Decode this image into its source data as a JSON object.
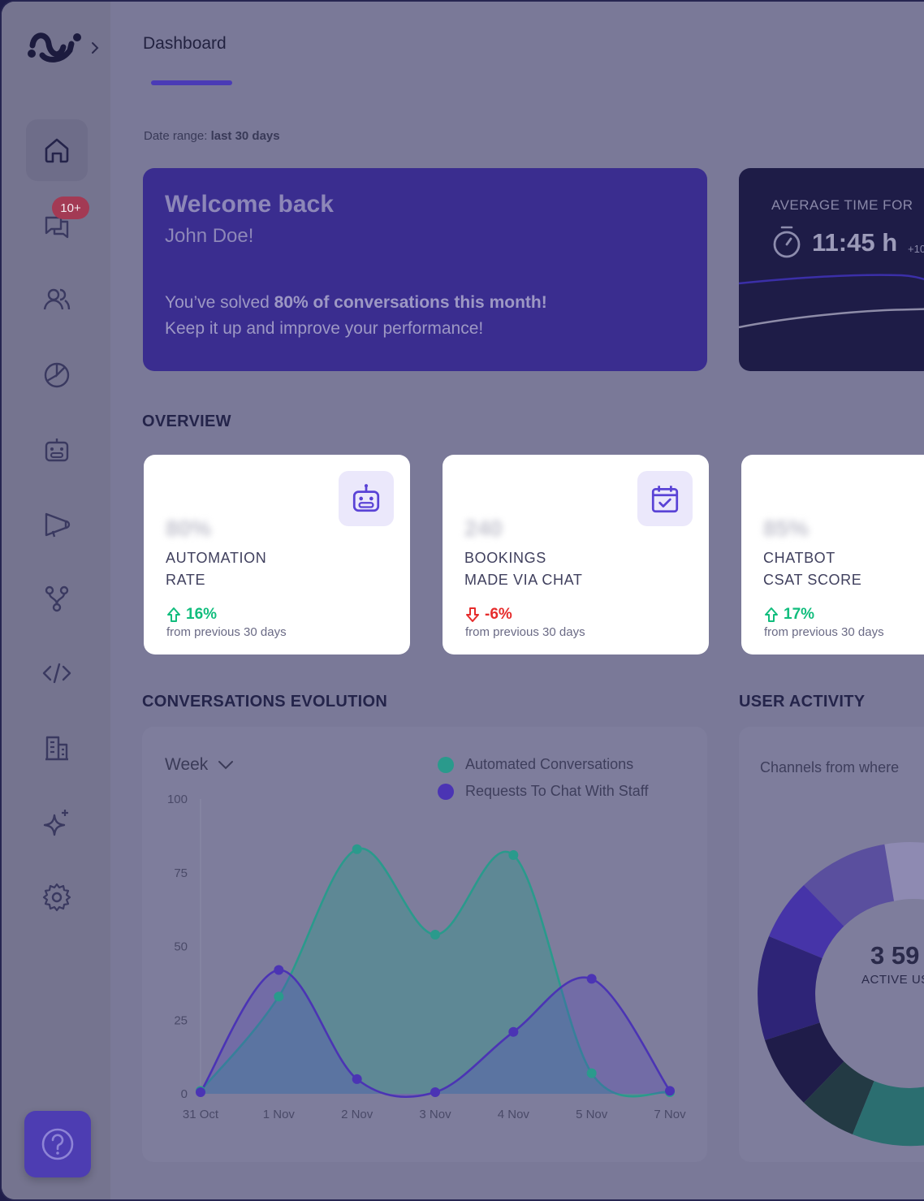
{
  "sidebar": {
    "badge": "10+",
    "items": [
      {
        "icon": "home-icon"
      },
      {
        "icon": "chat-icon"
      },
      {
        "icon": "users-icon"
      },
      {
        "icon": "pie-chart-icon"
      },
      {
        "icon": "robot-icon"
      },
      {
        "icon": "megaphone-icon"
      },
      {
        "icon": "workflow-icon"
      },
      {
        "icon": "code-icon"
      },
      {
        "icon": "building-icon"
      },
      {
        "icon": "sparkles-icon"
      },
      {
        "icon": "gear-icon"
      }
    ],
    "help_icon": "help-circle-icon"
  },
  "header": {
    "title": "Dashboard",
    "date_range_label": "Date range:",
    "date_range_value": "last 30 days"
  },
  "welcome": {
    "heading": "Welcome back",
    "name": "John Doe!",
    "msg_prefix": "You’ve solved ",
    "msg_bold": "80% of conversations this month!",
    "msg_line2": "Keep it up and improve your performance!"
  },
  "avg_time": {
    "label": "AVERAGE TIME FOR",
    "value": "11:45 h",
    "delta": "+10"
  },
  "overview": {
    "heading": "OVERVIEW",
    "cards": [
      {
        "value": "80%",
        "label_line1": "AUTOMATION",
        "label_line2": "RATE",
        "delta": "16%",
        "direction": "up",
        "sub": "from previous 30 days",
        "icon": "robot-icon"
      },
      {
        "value": "240",
        "label_line1": "BOOKINGS",
        "label_line2": "MADE VIA CHAT",
        "delta": "-6%",
        "direction": "down",
        "sub": "from previous 30 days",
        "icon": "calendar-check-icon"
      },
      {
        "value": "85%",
        "label_line1": "CHATBOT",
        "label_line2": "CSAT SCORE",
        "delta": "17%",
        "direction": "up",
        "sub": "from previous 30 days",
        "icon": ""
      }
    ]
  },
  "evolution": {
    "heading": "CONVERSATIONS EVOLUTION",
    "period": "Week",
    "colors": {
      "automated": "#2a9a8c",
      "staff": "#4b34b4"
    }
  },
  "chart_data": {
    "type": "area",
    "categories": [
      "31 Oct",
      "1 Nov",
      "2 Nov",
      "3 Nov",
      "4 Nov",
      "5 Nov",
      "7 Nov"
    ],
    "series": [
      {
        "name": "Automated Conversations",
        "values": [
          1,
          33,
          83,
          54,
          81,
          7,
          0
        ]
      },
      {
        "name": "Requests To Chat With Staff",
        "values": [
          0,
          42,
          5,
          0,
          21,
          39,
          1
        ]
      }
    ],
    "yticks": [
      0,
      25,
      50,
      75,
      100
    ],
    "ylim": [
      0,
      100
    ],
    "grid": false,
    "legend": "top-right"
  },
  "user_activity": {
    "heading": "USER ACTIVITY",
    "subtitle": "Channels from where",
    "total": "3 59",
    "total_label": "ACTIVE US"
  }
}
